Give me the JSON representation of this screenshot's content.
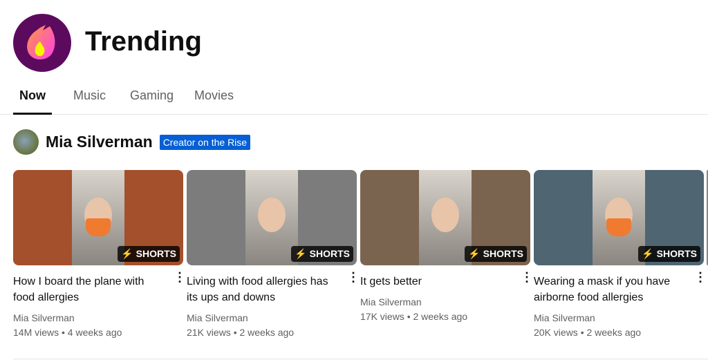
{
  "header": {
    "title": "Trending",
    "icon": "trending-flame-icon"
  },
  "tabs": [
    {
      "label": "Now",
      "active": true
    },
    {
      "label": "Music"
    },
    {
      "label": "Gaming"
    },
    {
      "label": "Movies"
    }
  ],
  "creator": {
    "name": "Mia Silverman",
    "badge": "Creator on the Rise",
    "badge_color": "#065fd4"
  },
  "videos": [
    {
      "title": "How I board the plane with food allergies",
      "channel": "Mia Silverman",
      "meta": "14M views • 4 weeks ago",
      "badge": "SHORTS",
      "bg": "#a4502c"
    },
    {
      "title": "Living with food allergies has its ups and downs",
      "channel": "Mia Silverman",
      "meta": "21K views • 2 weeks ago",
      "badge": "SHORTS",
      "bg": "#7c7c7c"
    },
    {
      "title": "It gets better",
      "channel": "Mia Silverman",
      "meta": "17K views • 2 weeks ago",
      "badge": "SHORTS",
      "bg": "#7b644f"
    },
    {
      "title": "Wearing a mask if you have airborne food allergies",
      "channel": "Mia Silverman",
      "meta": "20K views • 2 weeks ago",
      "badge": "SHORTS",
      "bg": "#4f6572"
    }
  ]
}
